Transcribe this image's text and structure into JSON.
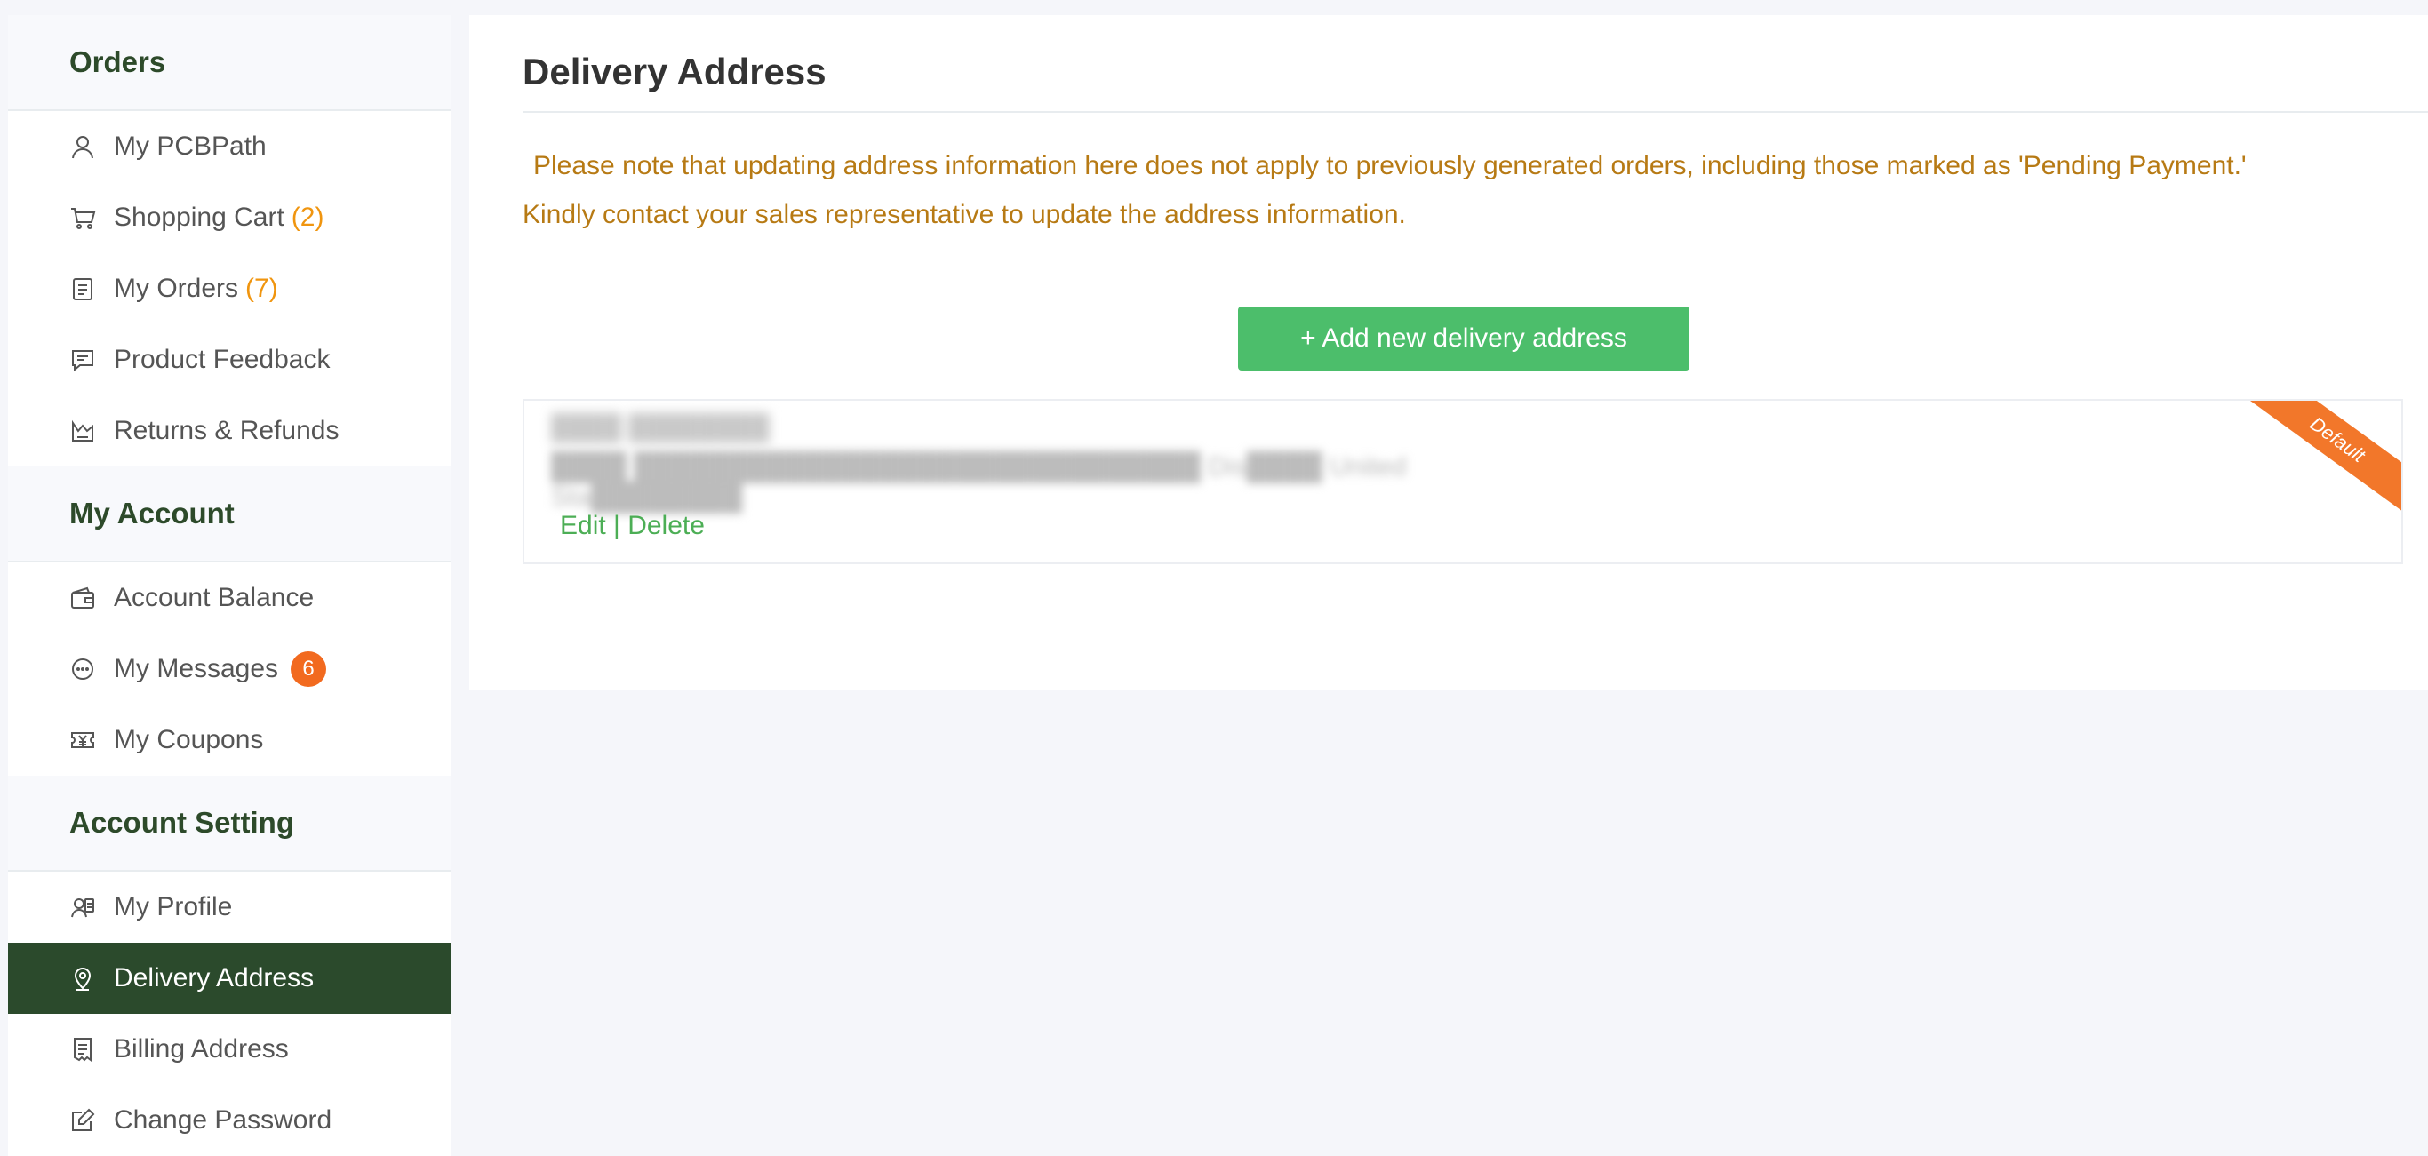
{
  "sidebar": {
    "sections": [
      {
        "title": "Orders",
        "items": [
          {
            "label": "My PCBPath",
            "icon": "user-icon"
          },
          {
            "label": "Shopping Cart",
            "count": "(2)",
            "icon": "cart-icon"
          },
          {
            "label": "My Orders",
            "count": "(7)",
            "icon": "orders-icon"
          },
          {
            "label": "Product Feedback",
            "icon": "feedback-icon"
          },
          {
            "label": "Returns & Refunds",
            "icon": "returns-icon"
          }
        ]
      },
      {
        "title": "My Account",
        "items": [
          {
            "label": "Account Balance",
            "icon": "wallet-icon"
          },
          {
            "label": "My Messages",
            "badge": "6",
            "icon": "message-icon"
          },
          {
            "label": "My Coupons",
            "icon": "coupon-icon"
          }
        ]
      },
      {
        "title": "Account Setting",
        "items": [
          {
            "label": "My Profile",
            "icon": "profile-icon"
          },
          {
            "label": "Delivery Address",
            "icon": "location-pin-icon",
            "active": true
          },
          {
            "label": "Billing Address",
            "icon": "receipt-icon"
          },
          {
            "label": "Change Password",
            "icon": "edit-icon"
          }
        ]
      }
    ]
  },
  "main": {
    "title": "Delivery Address",
    "notice_line1": "Please note that updating address information here does not apply to previously generated orders, including those marked as 'Pending Payment.'",
    "notice_line2": "Kindly contact your sales representative to update the address information.",
    "add_button_label": "+ Add new delivery address",
    "address": {
      "name": "████ ████████",
      "line": "████ ██████████████████████████████ Dis████ United Sta████████",
      "edit_label": "Edit",
      "separator": "|",
      "delete_label": "Delete",
      "ribbon": "Default"
    }
  },
  "colors": {
    "brand_dark_green": "#2b4a2c",
    "accent_green": "#4cbe6b",
    "link_green": "#4cae55",
    "notice_text": "#b77a14",
    "count_orange": "#f0950f",
    "badge_orange": "#f26a1f",
    "ribbon_orange": "#f2772a"
  }
}
